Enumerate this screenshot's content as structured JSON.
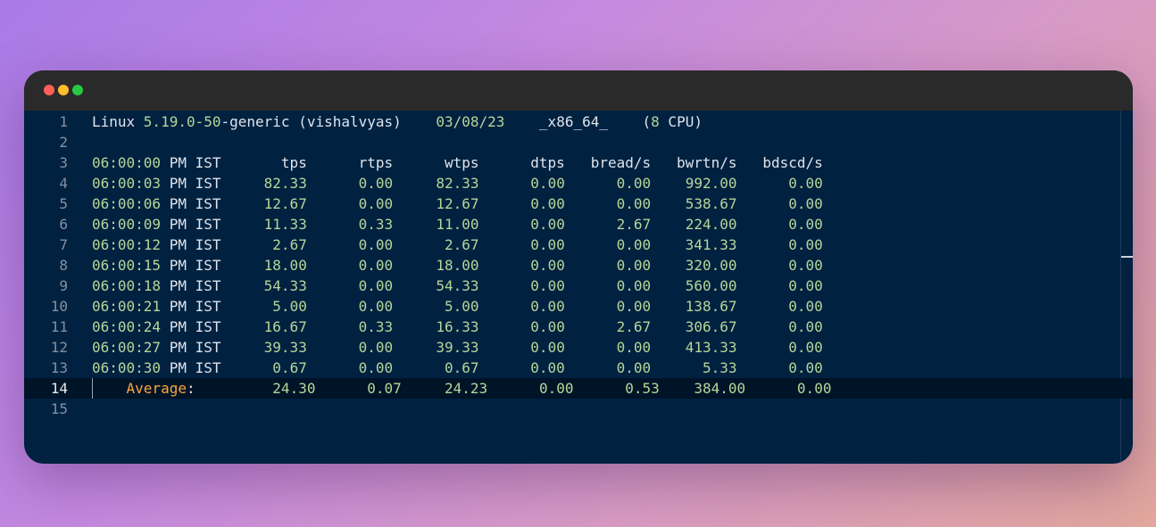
{
  "window": {
    "controls": [
      "close",
      "minimize",
      "maximize"
    ]
  },
  "colors": {
    "background_gradient": [
      "#a97ae6",
      "#c489e0",
      "#d79ac6",
      "#e2a79c"
    ],
    "editor_bg": "#002140",
    "titlebar_bg": "#2a2a2a",
    "text": "#dfe4ec",
    "number": "#b5d69a",
    "keyword": "#f9a640",
    "line_number": "#8590a2"
  },
  "editor": {
    "current_line": 14,
    "lines": [
      {
        "n": "1",
        "parts": [
          [
            "Linux ",
            "t"
          ],
          [
            "5.19.0-50",
            "n"
          ],
          [
            "-generic (vishalvyas)    ",
            "t"
          ],
          [
            "03/08/23",
            "n"
          ],
          [
            "    _x86_64_    (",
            "t"
          ],
          [
            "8",
            "n"
          ],
          [
            " CPU)",
            "t"
          ]
        ]
      },
      {
        "n": "2",
        "parts": []
      },
      {
        "n": "3",
        "parts": [
          [
            "06:00:00",
            "n"
          ],
          [
            " PM IST       tps      rtps      wtps      dtps   bread/s   bwrtn/s   bdscd/s",
            "t"
          ]
        ]
      },
      {
        "n": "4",
        "parts": [
          [
            "06:00:03",
            "n"
          ],
          [
            " PM IST     ",
            "t"
          ],
          [
            "82.33",
            "n"
          ],
          [
            "      ",
            "t"
          ],
          [
            "0.00",
            "n"
          ],
          [
            "     ",
            "t"
          ],
          [
            "82.33",
            "n"
          ],
          [
            "      ",
            "t"
          ],
          [
            "0.00",
            "n"
          ],
          [
            "      ",
            "t"
          ],
          [
            "0.00",
            "n"
          ],
          [
            "    ",
            "t"
          ],
          [
            "992.00",
            "n"
          ],
          [
            "      ",
            "t"
          ],
          [
            "0.00",
            "n"
          ]
        ]
      },
      {
        "n": "5",
        "parts": [
          [
            "06:00:06",
            "n"
          ],
          [
            " PM IST     ",
            "t"
          ],
          [
            "12.67",
            "n"
          ],
          [
            "      ",
            "t"
          ],
          [
            "0.00",
            "n"
          ],
          [
            "     ",
            "t"
          ],
          [
            "12.67",
            "n"
          ],
          [
            "      ",
            "t"
          ],
          [
            "0.00",
            "n"
          ],
          [
            "      ",
            "t"
          ],
          [
            "0.00",
            "n"
          ],
          [
            "    ",
            "t"
          ],
          [
            "538.67",
            "n"
          ],
          [
            "      ",
            "t"
          ],
          [
            "0.00",
            "n"
          ]
        ]
      },
      {
        "n": "6",
        "parts": [
          [
            "06:00:09",
            "n"
          ],
          [
            " PM IST     ",
            "t"
          ],
          [
            "11.33",
            "n"
          ],
          [
            "      ",
            "t"
          ],
          [
            "0.33",
            "n"
          ],
          [
            "     ",
            "t"
          ],
          [
            "11.00",
            "n"
          ],
          [
            "      ",
            "t"
          ],
          [
            "0.00",
            "n"
          ],
          [
            "      ",
            "t"
          ],
          [
            "2.67",
            "n"
          ],
          [
            "    ",
            "t"
          ],
          [
            "224.00",
            "n"
          ],
          [
            "      ",
            "t"
          ],
          [
            "0.00",
            "n"
          ]
        ]
      },
      {
        "n": "7",
        "parts": [
          [
            "06:00:12",
            "n"
          ],
          [
            " PM IST      ",
            "t"
          ],
          [
            "2.67",
            "n"
          ],
          [
            "      ",
            "t"
          ],
          [
            "0.00",
            "n"
          ],
          [
            "      ",
            "t"
          ],
          [
            "2.67",
            "n"
          ],
          [
            "      ",
            "t"
          ],
          [
            "0.00",
            "n"
          ],
          [
            "      ",
            "t"
          ],
          [
            "0.00",
            "n"
          ],
          [
            "    ",
            "t"
          ],
          [
            "341.33",
            "n"
          ],
          [
            "      ",
            "t"
          ],
          [
            "0.00",
            "n"
          ]
        ]
      },
      {
        "n": "8",
        "parts": [
          [
            "06:00:15",
            "n"
          ],
          [
            " PM IST     ",
            "t"
          ],
          [
            "18.00",
            "n"
          ],
          [
            "      ",
            "t"
          ],
          [
            "0.00",
            "n"
          ],
          [
            "     ",
            "t"
          ],
          [
            "18.00",
            "n"
          ],
          [
            "      ",
            "t"
          ],
          [
            "0.00",
            "n"
          ],
          [
            "      ",
            "t"
          ],
          [
            "0.00",
            "n"
          ],
          [
            "    ",
            "t"
          ],
          [
            "320.00",
            "n"
          ],
          [
            "      ",
            "t"
          ],
          [
            "0.00",
            "n"
          ]
        ]
      },
      {
        "n": "9",
        "parts": [
          [
            "06:00:18",
            "n"
          ],
          [
            " PM IST     ",
            "t"
          ],
          [
            "54.33",
            "n"
          ],
          [
            "      ",
            "t"
          ],
          [
            "0.00",
            "n"
          ],
          [
            "     ",
            "t"
          ],
          [
            "54.33",
            "n"
          ],
          [
            "      ",
            "t"
          ],
          [
            "0.00",
            "n"
          ],
          [
            "      ",
            "t"
          ],
          [
            "0.00",
            "n"
          ],
          [
            "    ",
            "t"
          ],
          [
            "560.00",
            "n"
          ],
          [
            "      ",
            "t"
          ],
          [
            "0.00",
            "n"
          ]
        ]
      },
      {
        "n": "10",
        "parts": [
          [
            "06:00:21",
            "n"
          ],
          [
            " PM IST      ",
            "t"
          ],
          [
            "5.00",
            "n"
          ],
          [
            "      ",
            "t"
          ],
          [
            "0.00",
            "n"
          ],
          [
            "      ",
            "t"
          ],
          [
            "5.00",
            "n"
          ],
          [
            "      ",
            "t"
          ],
          [
            "0.00",
            "n"
          ],
          [
            "      ",
            "t"
          ],
          [
            "0.00",
            "n"
          ],
          [
            "    ",
            "t"
          ],
          [
            "138.67",
            "n"
          ],
          [
            "      ",
            "t"
          ],
          [
            "0.00",
            "n"
          ]
        ]
      },
      {
        "n": "11",
        "parts": [
          [
            "06:00:24",
            "n"
          ],
          [
            " PM IST     ",
            "t"
          ],
          [
            "16.67",
            "n"
          ],
          [
            "      ",
            "t"
          ],
          [
            "0.33",
            "n"
          ],
          [
            "     ",
            "t"
          ],
          [
            "16.33",
            "n"
          ],
          [
            "      ",
            "t"
          ],
          [
            "0.00",
            "n"
          ],
          [
            "      ",
            "t"
          ],
          [
            "2.67",
            "n"
          ],
          [
            "    ",
            "t"
          ],
          [
            "306.67",
            "n"
          ],
          [
            "      ",
            "t"
          ],
          [
            "0.00",
            "n"
          ]
        ]
      },
      {
        "n": "12",
        "parts": [
          [
            "06:00:27",
            "n"
          ],
          [
            " PM IST     ",
            "t"
          ],
          [
            "39.33",
            "n"
          ],
          [
            "      ",
            "t"
          ],
          [
            "0.00",
            "n"
          ],
          [
            "     ",
            "t"
          ],
          [
            "39.33",
            "n"
          ],
          [
            "      ",
            "t"
          ],
          [
            "0.00",
            "n"
          ],
          [
            "      ",
            "t"
          ],
          [
            "0.00",
            "n"
          ],
          [
            "    ",
            "t"
          ],
          [
            "413.33",
            "n"
          ],
          [
            "      ",
            "t"
          ],
          [
            "0.00",
            "n"
          ]
        ]
      },
      {
        "n": "13",
        "parts": [
          [
            "06:00:30",
            "n"
          ],
          [
            " PM IST      ",
            "t"
          ],
          [
            "0.67",
            "n"
          ],
          [
            "      ",
            "t"
          ],
          [
            "0.00",
            "n"
          ],
          [
            "      ",
            "t"
          ],
          [
            "0.67",
            "n"
          ],
          [
            "      ",
            "t"
          ],
          [
            "0.00",
            "n"
          ],
          [
            "      ",
            "t"
          ],
          [
            "0.00",
            "n"
          ],
          [
            "      ",
            "t"
          ],
          [
            "5.33",
            "n"
          ],
          [
            "      ",
            "t"
          ],
          [
            "0.00",
            "n"
          ]
        ]
      },
      {
        "n": "14",
        "parts": [
          [
            "    ",
            "t"
          ],
          [
            "Average",
            "k"
          ],
          [
            ":         ",
            "t"
          ],
          [
            "24.30",
            "n"
          ],
          [
            "      ",
            "t"
          ],
          [
            "0.07",
            "n"
          ],
          [
            "     ",
            "t"
          ],
          [
            "24.23",
            "n"
          ],
          [
            "      ",
            "t"
          ],
          [
            "0.00",
            "n"
          ],
          [
            "      ",
            "t"
          ],
          [
            "0.53",
            "n"
          ],
          [
            "    ",
            "t"
          ],
          [
            "384.00",
            "n"
          ],
          [
            "      ",
            "t"
          ],
          [
            "0.00",
            "n"
          ]
        ]
      },
      {
        "n": "15",
        "parts": []
      }
    ]
  }
}
